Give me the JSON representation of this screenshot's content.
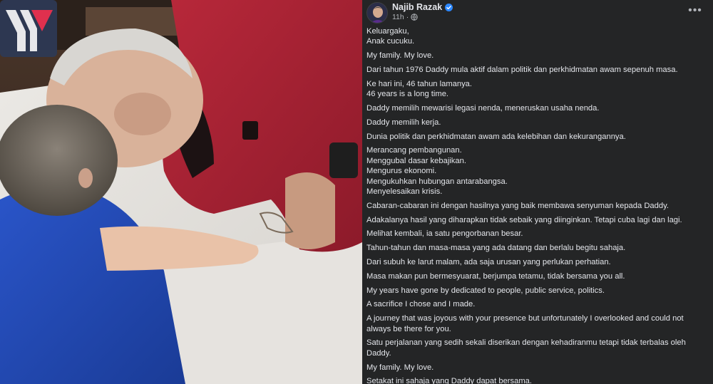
{
  "photo": {
    "alt": "",
    "logo_icon": "yy-triangle-logo-icon"
  },
  "post": {
    "author": "Najib Razak",
    "verified_icon": "verified-badge-icon",
    "time": "11h",
    "separator": "·",
    "audience_icon": "globe-icon",
    "more_icon": "more-options-icon",
    "more_label": "•••",
    "paragraphs": [
      [
        "Keluargaku,",
        "Anak cucuku."
      ],
      [
        "My family. My love."
      ],
      [
        "Dari tahun 1976 Daddy mula aktif dalam politik dan perkhidmatan awam sepenuh masa."
      ],
      [
        "Ke hari ini, 46 tahun lamanya.",
        "46 years is a long time."
      ],
      [
        "Daddy memilih mewarisi legasi nenda, meneruskan usaha nenda."
      ],
      [
        "Daddy memilih kerja."
      ],
      [
        "Dunia politik dan perkhidmatan awam ada kelebihan dan kekurangannya."
      ],
      [
        "Merancang pembangunan.",
        "Menggubal dasar kebajikan.",
        "Mengurus ekonomi.",
        "Mengukuhkan hubungan antarabangsa.",
        "Menyelesaikan krisis."
      ],
      [
        "Cabaran-cabaran ini dengan hasilnya yang baik membawa senyuman kepada Daddy."
      ],
      [
        "Adakalanya hasil yang diharapkan tidak sebaik yang diinginkan. Tetapi cuba lagi dan lagi."
      ],
      [
        "Melihat kembali, ia satu pengorbanan besar."
      ],
      [
        "Tahun-tahun dan masa-masa yang ada datang dan berlalu begitu sahaja."
      ],
      [
        "Dari subuh ke larut malam, ada saja urusan yang perlukan perhatian."
      ],
      [
        "Masa makan pun bermesyuarat, berjumpa tetamu, tidak bersama you all."
      ],
      [
        "My years have gone by dedicated to people, public service, politics."
      ],
      [
        "A sacrifice I chose and I made."
      ],
      [
        "A journey that was joyous with your presence but unfortunately I overlooked and could not",
        "always be there for you."
      ],
      [
        "Satu perjalanan yang sedih sekali diserikan dengan kehadiranmu tetapi tidak terbalas oleh Daddy."
      ],
      [
        "My family. My love."
      ],
      [
        "Setakat ini sahaja yang Daddy dapat bersama."
      ]
    ]
  }
}
